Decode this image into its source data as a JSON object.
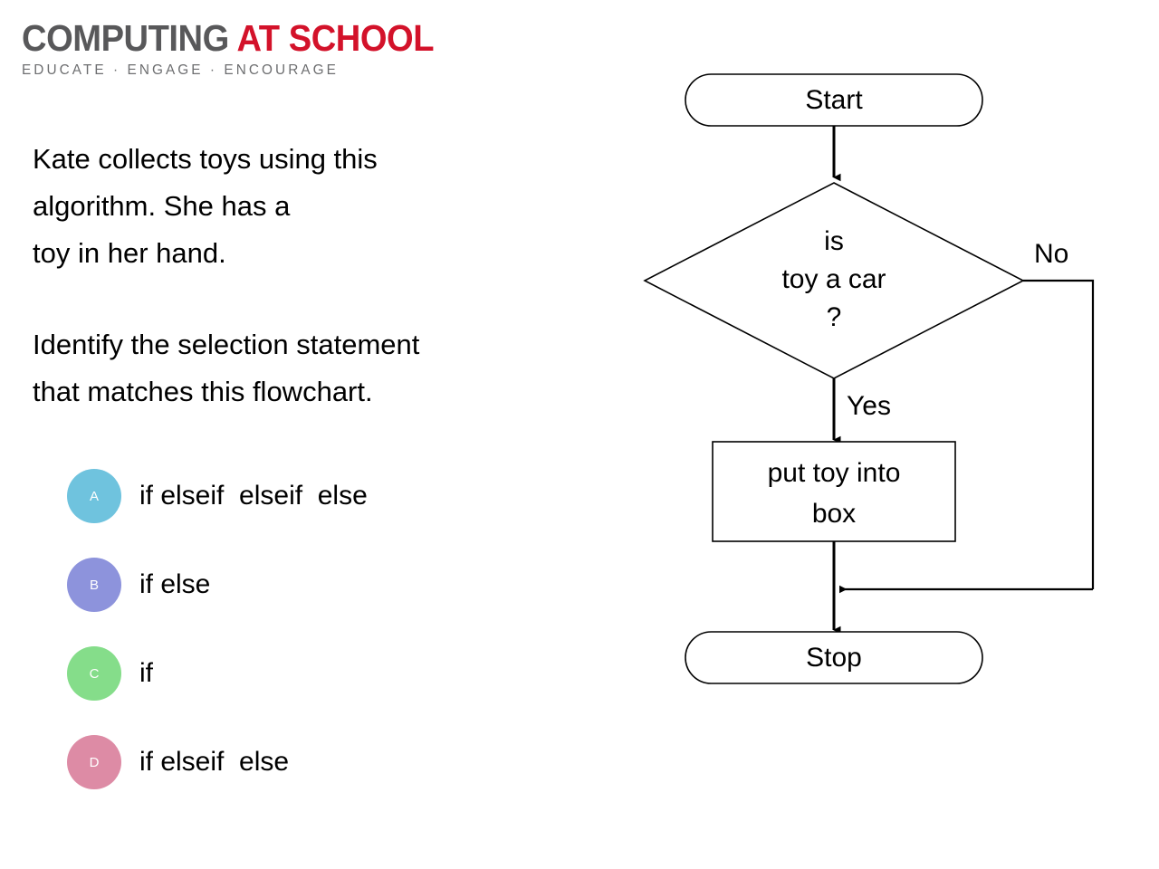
{
  "logo": {
    "word_primary": "COMPUTING",
    "word_accent": "AT SCHOOL",
    "tagline": "EDUCATE · ENGAGE · ENCOURAGE",
    "color_primary": "#58585A",
    "color_accent": "#D3122A",
    "color_tagline": "#6D6E70"
  },
  "content": {
    "intro_text": "Kate collects toys using this\nalgorithm.  She has a\ntoy in her hand.",
    "instruction_text": "Identify the selection statement\nthat matches this flowchart."
  },
  "options": [
    {
      "letter": "A",
      "label": "if elseif  elseif  else",
      "color": "#6FC3DE"
    },
    {
      "letter": "B",
      "label": "if else",
      "color": "#8D93DC"
    },
    {
      "letter": "C",
      "label": "if",
      "color": "#85DD8A"
    },
    {
      "letter": "D",
      "label": "if elseif  else",
      "color": "#DD8BA5"
    }
  ],
  "flowchart": {
    "start_label": "Start",
    "decision_line1": "is",
    "decision_line2": "toy a car",
    "decision_line3": "?",
    "branch_yes": "Yes",
    "branch_no": "No",
    "process_line1": "put toy into",
    "process_line2": "box",
    "stop_label": "Stop",
    "stroke_color": "#000000"
  }
}
